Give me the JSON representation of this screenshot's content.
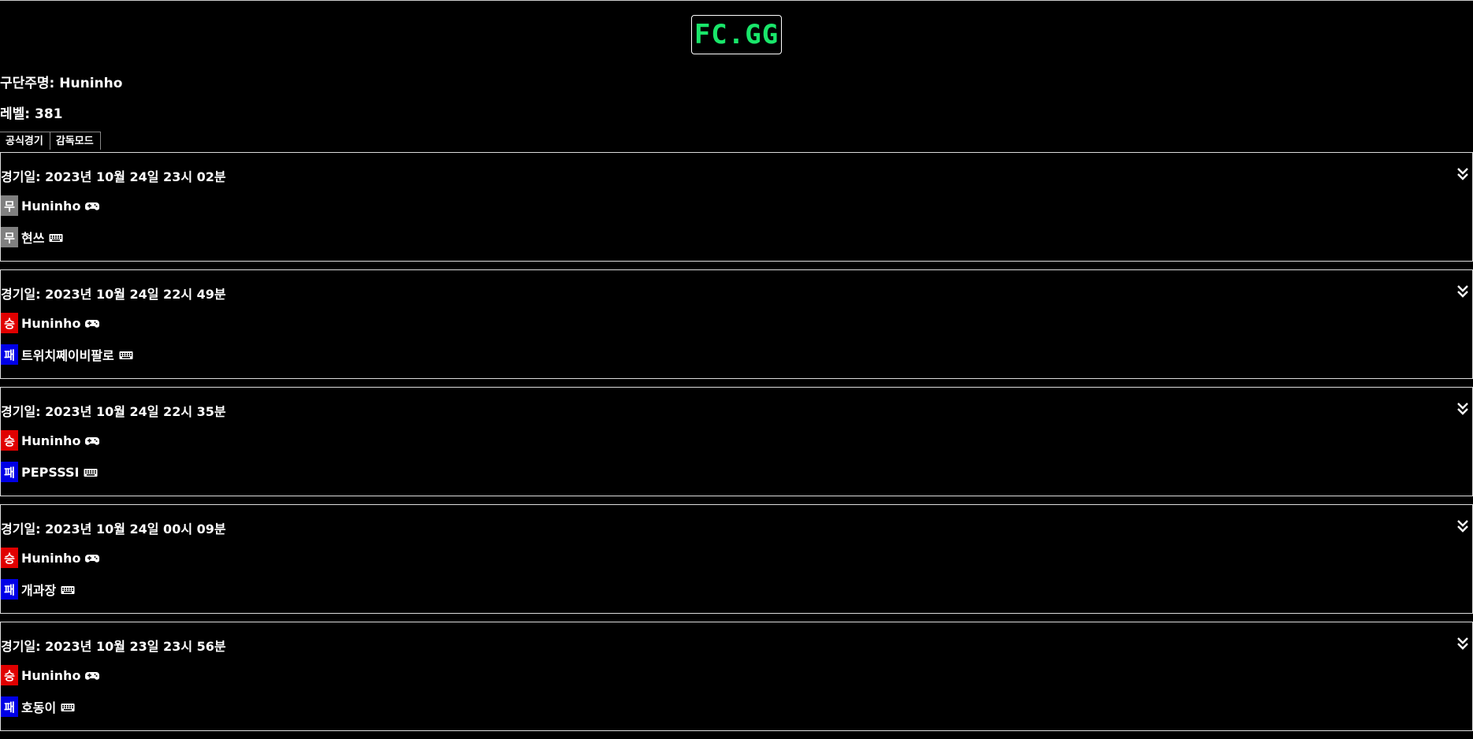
{
  "logo": {
    "text": "FC.GG"
  },
  "profile": {
    "manager_label": "구단주명: Huninho",
    "level_label": "레벨: 381"
  },
  "tabs": [
    {
      "label": "공식경기"
    },
    {
      "label": "감독모드"
    }
  ],
  "colors": {
    "win": "#e00000",
    "lose": "#0000e6",
    "draw": "#808080",
    "logo": "#19e66a"
  },
  "matches": [
    {
      "date": "경기일: 2023년 10월 24일 23시 02분",
      "players": [
        {
          "result": "무",
          "name": "Huninho",
          "device": "gamepad-icon"
        },
        {
          "result": "무",
          "name": "현쓰",
          "device": "keyboard-icon"
        }
      ]
    },
    {
      "date": "경기일: 2023년 10월 24일 22시 49분",
      "players": [
        {
          "result": "승",
          "name": "Huninho",
          "device": "gamepad-icon"
        },
        {
          "result": "패",
          "name": "트위치쩨이비팔로",
          "device": "keyboard-icon"
        }
      ]
    },
    {
      "date": "경기일: 2023년 10월 24일 22시 35분",
      "players": [
        {
          "result": "승",
          "name": "Huninho",
          "device": "gamepad-icon"
        },
        {
          "result": "패",
          "name": "PEPSSSI",
          "device": "keyboard-icon"
        }
      ]
    },
    {
      "date": "경기일: 2023년 10월 24일 00시 09분",
      "players": [
        {
          "result": "승",
          "name": "Huninho",
          "device": "gamepad-icon"
        },
        {
          "result": "패",
          "name": "개과장",
          "device": "keyboard-icon"
        }
      ]
    },
    {
      "date": "경기일: 2023년 10월 23일 23시 56분",
      "players": [
        {
          "result": "승",
          "name": "Huninho",
          "device": "gamepad-icon"
        },
        {
          "result": "패",
          "name": "호동이",
          "device": "keyboard-icon"
        }
      ]
    }
  ]
}
